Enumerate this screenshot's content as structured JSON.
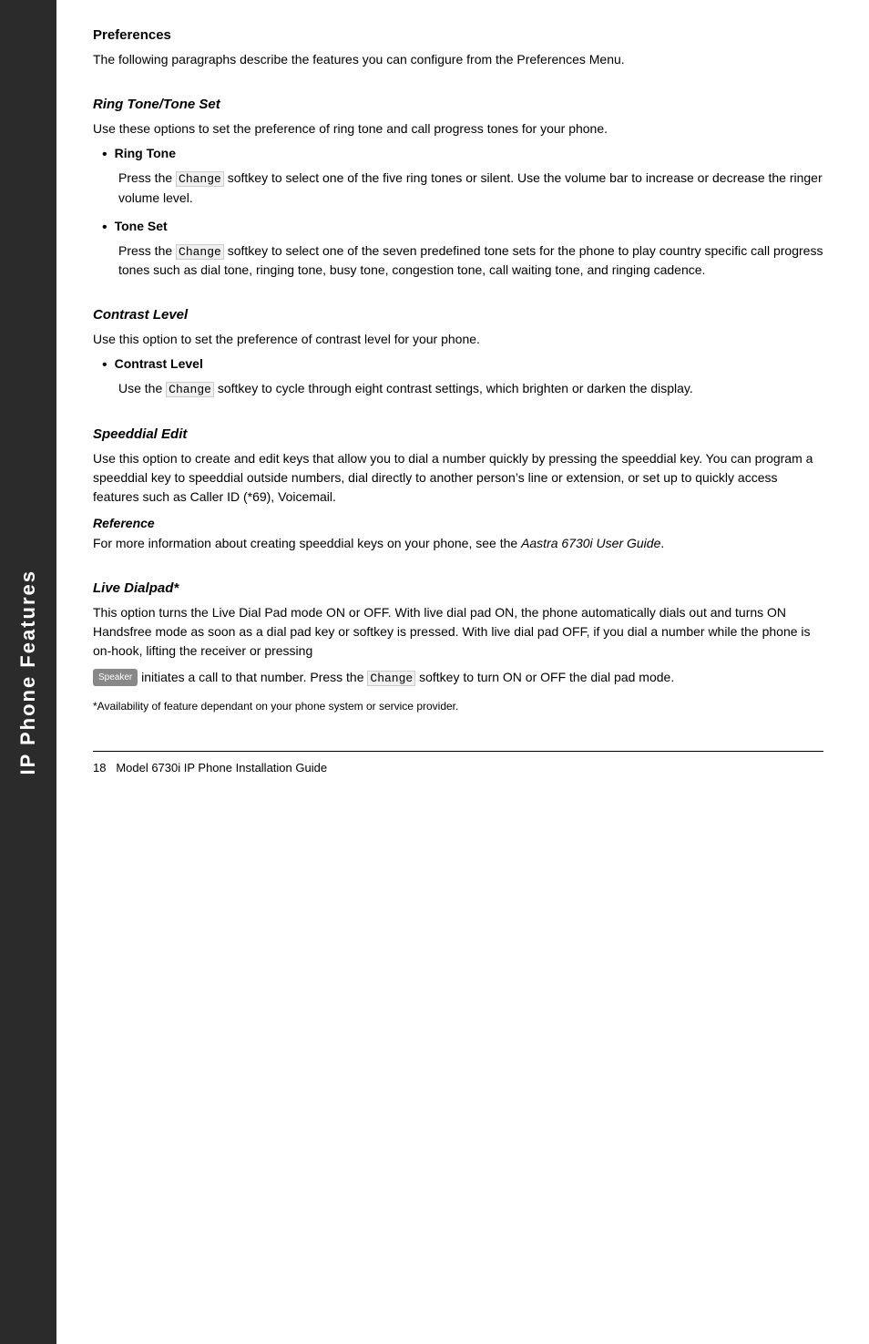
{
  "sidebar": {
    "label": "IP Phone Features"
  },
  "page": {
    "sections": [
      {
        "id": "preferences",
        "title": "Preferences",
        "is_italic": false,
        "paragraphs": [
          "The following paragraphs describe the features you can configure from the Preferences Menu."
        ],
        "bullets": []
      },
      {
        "id": "ring-tone-tone-set",
        "title": "Ring Tone/Tone Set",
        "is_italic": true,
        "paragraphs": [
          "Use these options to set the preference of ring tone and call progress tones for your phone."
        ],
        "bullets": [
          {
            "label": "Ring Tone",
            "description": "Press the Change softkey to select one of the five ring tones or silent. Use the volume bar to increase or decrease the ringer volume level."
          },
          {
            "label": "Tone Set",
            "description": "Press the Change softkey to select one of the seven predefined tone sets for the phone to play country specific call progress tones such as dial tone, ringing tone, busy tone, congestion tone, call waiting tone, and ringing cadence."
          }
        ]
      },
      {
        "id": "contrast-level",
        "title": "Contrast Level",
        "is_italic": true,
        "paragraphs": [
          "Use this option to set the preference of contrast level for your phone."
        ],
        "bullets": [
          {
            "label": "Contrast Level",
            "description": "Use the Change softkey to cycle through eight contrast settings, which brighten or darken the display."
          }
        ]
      },
      {
        "id": "speeddial-edit",
        "title": "Speeddial Edit",
        "is_italic": true,
        "paragraphs": [
          "Use this option to create and edit keys that allow you to dial a number quickly by pressing the speeddial key. You can program a speeddial key to speeddial outside numbers, dial directly to another person’s line or extension, or set up to quickly access features such as Caller ID (*69), Voicemail."
        ],
        "bullets": [],
        "reference": {
          "label": "Reference",
          "text": "For more information about creating speeddial keys on your phone, see the ",
          "italic_text": "Aastra 6730i User Guide",
          "text_after": "."
        }
      },
      {
        "id": "live-dialpad",
        "title": "Live Dialpad*",
        "is_italic": true,
        "paragraphs": [
          "This option turns the Live Dial Pad mode ON or OFF. With live dial pad ON, the phone automatically dials out and turns ON Handsfree mode as soon as a dial pad key or softkey is pressed. With live dial pad OFF, if you dial a number while the phone is on-hook, lifting the receiver or pressing"
        ],
        "inline_speaker": " initiates a call to that number. Press the Change softkey to turn ON or OFF the dial pad mode.",
        "speaker_label": "Speaker",
        "bullets": [],
        "footnote": "*Availability of feature dependant on your phone system or service provider."
      }
    ],
    "footer": {
      "page_number": "18",
      "title": "Model 6730i IP Phone Installation Guide"
    }
  }
}
